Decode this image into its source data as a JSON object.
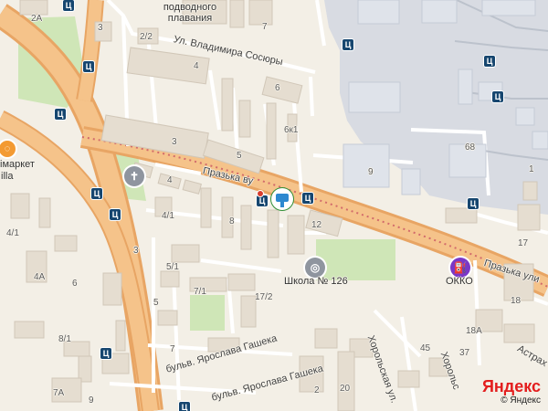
{
  "map": {
    "colors": {
      "background": "#f3efe6",
      "building": "#e5ddd0",
      "industrial": "#d8dbe2",
      "green": "#cfe6b7",
      "road_main": "#f5c38a",
      "road_outline": "#e8a564",
      "street": "#ffffff",
      "transit": "#16466f",
      "fuel": "#7a38c7"
    },
    "streets": {
      "vladimir_sosyury": "Ул. Владимира Сосюры",
      "prazhska_1": "Празька ву",
      "prazhska_2": "Празька ули",
      "horolska_1": "Хорольская ул.",
      "horolska_2": "Хорольс",
      "astrakhanska": "Астрах",
      "yaroslav_gashek_1": "бульв. Ярослава Гашека",
      "yaroslav_gashek_2": "бульв. Ярослава Гашека"
    },
    "places": {
      "top_center": "подводного плавания",
      "left_market": "імаркет",
      "left_market_2": "illa",
      "school": "Школа № 126",
      "okko": "ОККО"
    },
    "house_numbers": {
      "h2A": "2А",
      "h3": "3",
      "h2_2": "2/2",
      "h4": "4",
      "h6": "6",
      "h7": "7",
      "h6k1": "6к1",
      "h5": "5",
      "h3b": "3",
      "h9": "9",
      "h68": "68",
      "h1": "1",
      "h4b": "4",
      "h4_1": "4/1",
      "h8": "8",
      "h12": "12",
      "h17": "17",
      "h5_1": "5/1",
      "h7_1": "7/1",
      "h17_2": "17/2",
      "h4_1b": "4/1",
      "h4A": "4А",
      "h6b": "6",
      "h8_1": "8/1",
      "h3c": "3",
      "h5b": "5",
      "h7b": "7",
      "h18": "18",
      "h18A": "18А",
      "h45": "45",
      "h37": "37",
      "h20": "20",
      "h2": "2",
      "h7A": "7А",
      "h9b": "9"
    },
    "attribution": {
      "brand": "Яндекс",
      "subtitle": "© Яндекс"
    }
  }
}
